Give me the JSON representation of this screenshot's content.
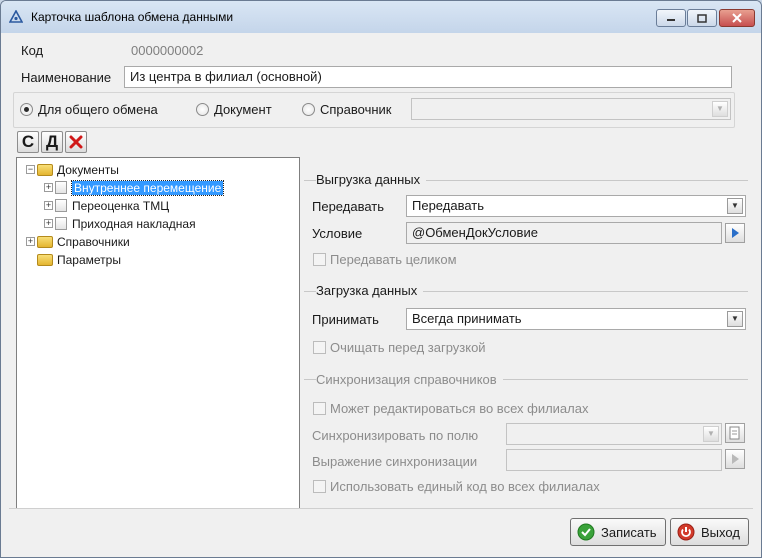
{
  "window": {
    "title": "Карточка шаблона обмена данными"
  },
  "code": {
    "label": "Код",
    "value": "0000000002"
  },
  "name": {
    "label": "Наименование",
    "value": "Из центра в филиал (основной)"
  },
  "exchange_type": {
    "options": [
      {
        "label": "Для общего обмена",
        "selected": true
      },
      {
        "label": "Документ",
        "selected": false
      },
      {
        "label": "Справочник",
        "selected": false
      }
    ],
    "reference_value": ""
  },
  "toolbar": {
    "create": "С",
    "delete_doc": "Д",
    "delete_icon": "delete-icon"
  },
  "tree": {
    "documents": "Документы",
    "internal_move": "Внутреннее перемещение",
    "revaluation": "Переоценка ТМЦ",
    "incoming_invoice": "Приходная накладная",
    "references": "Справочники",
    "parameters": "Параметры"
  },
  "export": {
    "title": "Выгрузка данных",
    "transfer_label": "Передавать",
    "transfer_value": "Передавать",
    "condition_label": "Условие",
    "condition_value": "@ОбменДокУсловие",
    "transfer_whole": "Передавать целиком"
  },
  "import": {
    "title": "Загрузка данных",
    "accept_label": "Принимать",
    "accept_value": "Всегда принимать",
    "clear_before": "Очищать перед загрузкой"
  },
  "sync": {
    "title": "Синхронизация справочников",
    "edit_all": "Может редактироваться во всех филиалах",
    "sync_field_label": "Синхронизировать по полю",
    "sync_field_value": "",
    "sync_expr_label": "Выражение синхронизации",
    "sync_expr_value": "",
    "single_code": "Использовать единый код во всех филиалах"
  },
  "buttons": {
    "save": "Записать",
    "exit": "Выход"
  },
  "colors": {
    "selection": "#3399ff",
    "save_icon": "#3aa23a",
    "exit_icon": "#d23a2a",
    "delete_icon": "#d01818"
  }
}
